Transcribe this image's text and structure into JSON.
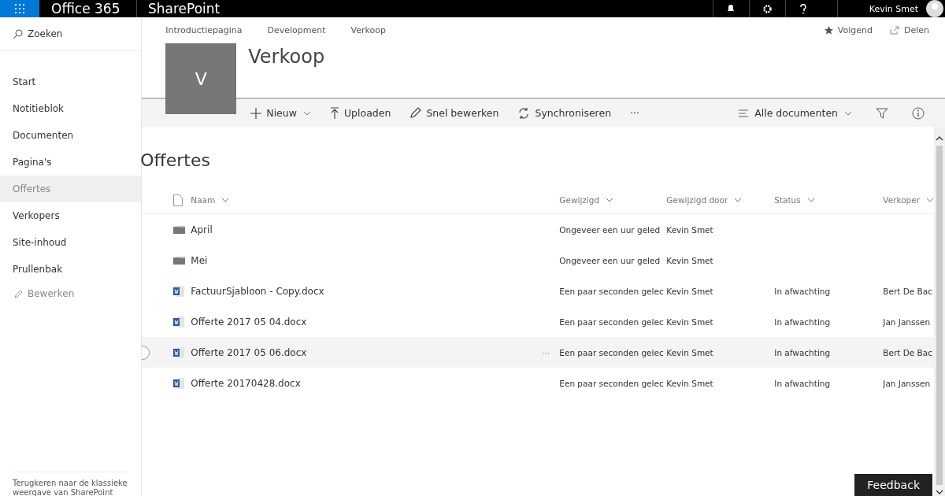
{
  "top_bar": {
    "app": "Office 365",
    "product": "SharePoint",
    "user": "Kevin Smet"
  },
  "sidebar": {
    "search": {
      "placeholder": "Zoeken"
    },
    "items": [
      {
        "label": "Start",
        "selected": false
      },
      {
        "label": "Notitieblok",
        "selected": false
      },
      {
        "label": "Documenten",
        "selected": false
      },
      {
        "label": "Pagina's",
        "selected": false
      },
      {
        "label": "Offertes",
        "selected": true
      },
      {
        "label": "Verkopers",
        "selected": false
      },
      {
        "label": "Site-inhoud",
        "selected": false
      },
      {
        "label": "Prullenbak",
        "selected": false
      }
    ],
    "edit": "Bewerken",
    "footer": "Terugkeren naar de klassieke weergave van SharePoint"
  },
  "breadcrumbs": [
    "Introductiepagina",
    "Development",
    "Verkoop"
  ],
  "site_actions": [
    {
      "kind": "follow",
      "label": "Volgend"
    },
    {
      "kind": "share",
      "label": "Delen"
    }
  ],
  "site": {
    "logo": "V",
    "title": "Verkoop"
  },
  "commands": [
    {
      "kind": "new",
      "label": "Nieuw"
    },
    {
      "kind": "upload",
      "label": "Uploaden"
    },
    {
      "kind": "edit",
      "label": "Snel bewerken"
    },
    {
      "kind": "sync",
      "label": "Synchroniseren"
    },
    {
      "kind": "more",
      "label": "···"
    }
  ],
  "view": {
    "label": "Alle documenten"
  },
  "list": {
    "title": "Offertes",
    "columns": [
      "Naam",
      "Gewijzigd",
      "Gewijzigd door",
      "Status",
      "Verkoper"
    ],
    "rows": [
      {
        "kind": "folder",
        "name": "April",
        "modified": "Ongeveer een uur geled",
        "by": "Kevin Smet",
        "hovered": false
      },
      {
        "kind": "folder",
        "name": "Mei",
        "modified": "Ongeveer een uur geled",
        "by": "Kevin Smet",
        "hovered": false
      },
      {
        "kind": "word",
        "name": "FactuurSjabloon - Copy.docx",
        "modified": "Een paar seconden gelec",
        "by": "Kevin Smet",
        "status": "In afwachting",
        "seller": "Bert De Bac",
        "hovered": false
      },
      {
        "kind": "word",
        "name": "Offerte 2017 05 04.docx",
        "modified": "Een paar seconden gelec",
        "by": "Kevin Smet",
        "status": "In afwachting",
        "seller": "Jan Janssen",
        "hovered": false
      },
      {
        "kind": "word",
        "name": "Offerte 2017 05 06.docx",
        "modified": "Een paar seconden gelec",
        "by": "Kevin Smet",
        "status": "In afwachting",
        "seller": "Bert De Bac",
        "hovered": true,
        "more": "···"
      },
      {
        "kind": "word",
        "name": "Offerte 20170428.docx",
        "modified": "Een paar seconden gelec",
        "by": "Kevin Smet",
        "status": "In afwachting",
        "seller": "Jan Janssen",
        "hovered": false
      }
    ]
  },
  "feedback": "Feedback"
}
